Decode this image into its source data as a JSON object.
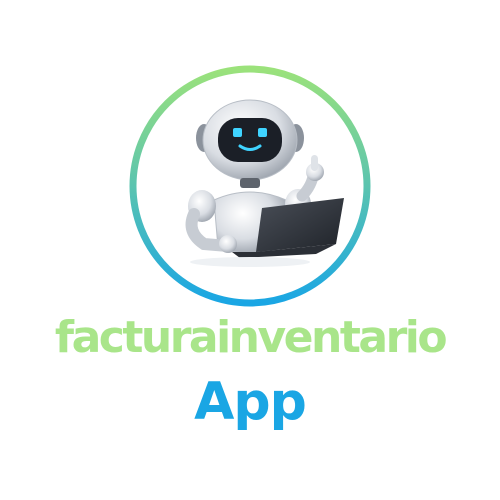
{
  "brand": {
    "name_line": "facturainventario",
    "app_line": "App"
  },
  "logo": {
    "icon": "robot-with-laptop-icon",
    "ring_gradient": [
      "#9be27b",
      "#1aa6e4"
    ]
  },
  "colors": {
    "name_color": "#a9e58a",
    "app_color": "#1aa6e4",
    "background": "#ffffff"
  }
}
